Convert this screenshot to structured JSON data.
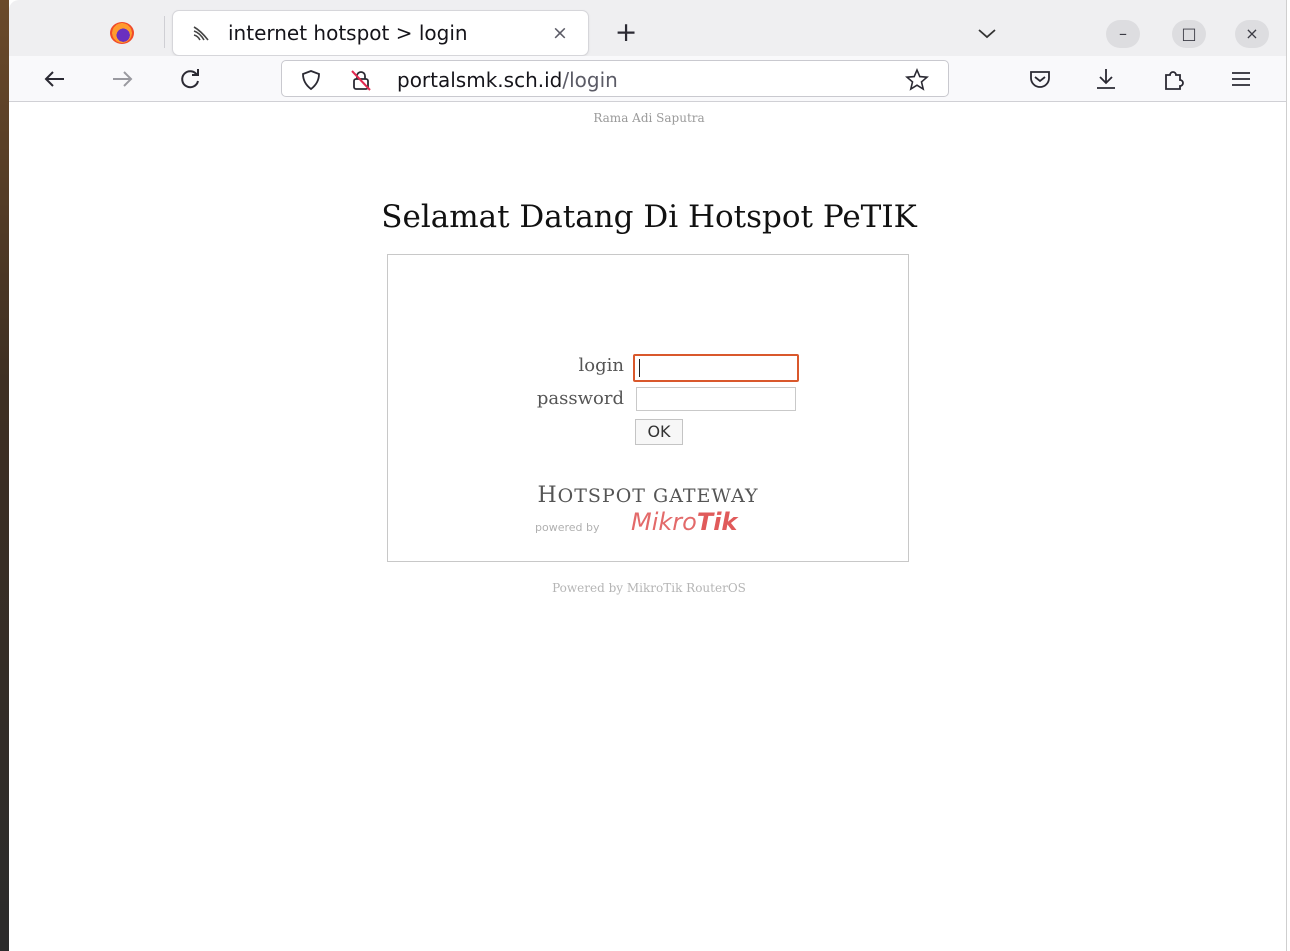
{
  "browser": {
    "tab": {
      "title": "internet hotspot > login",
      "favicon": "wifi-icon",
      "close": "×"
    },
    "new_tab": "+",
    "window_controls": {
      "minimize": "–",
      "maximize": "□",
      "close": "×"
    },
    "url": {
      "domain": "portalsmk.sch.id",
      "path": "/login"
    },
    "icons": [
      "back-icon",
      "forward-icon",
      "reload-icon",
      "shield-icon",
      "lock-slash-icon",
      "star-icon",
      "pocket-icon",
      "download-icon",
      "extensions-icon",
      "menu-icon"
    ]
  },
  "page": {
    "author": "Rama Adi Saputra",
    "welcome": "Selamat Datang Di Hotspot PeTIK",
    "form": {
      "login_label": "login",
      "login_value": "",
      "password_label": "password",
      "password_value": "",
      "submit_label": "OK"
    },
    "gateway": {
      "title_first": "H",
      "title_rest": "OTSPOT GATEWAY",
      "powered_by": "powered by",
      "brand_light": "Mikro",
      "brand_bold": "Tik"
    },
    "footer": "Powered by MikroTik RouterOS"
  },
  "colors": {
    "focus_border": "#d9582c",
    "brand": "#e05a5a"
  }
}
